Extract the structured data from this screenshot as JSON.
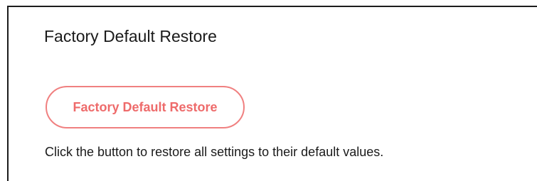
{
  "section": {
    "title": "Factory Default Restore",
    "button_label": "Factory Default Restore",
    "description": "Click the button to restore all settings to their default values."
  },
  "colors": {
    "accent": "#ee6b6b",
    "button_border": "#f08080",
    "text": "#1a1a1a",
    "panel_border": "#1c1c1c"
  }
}
